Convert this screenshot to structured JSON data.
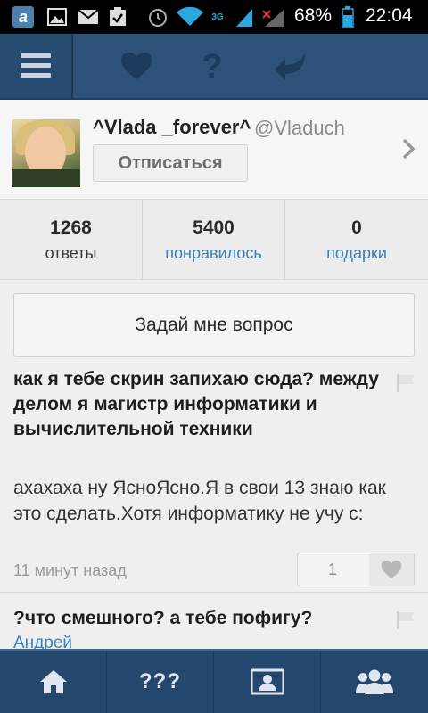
{
  "status_bar": {
    "app_icon_letter": "a",
    "network_type": "3G",
    "battery_percent": "68%",
    "time": "22:04",
    "icons": [
      "app-icon",
      "gallery-icon",
      "mail-icon",
      "clipboard-check-icon",
      "alarm-icon",
      "wifi-icon",
      "signal-icon",
      "signal-icon",
      "battery-icon"
    ]
  },
  "nav": {
    "icons": [
      "menu-icon",
      "heart-icon",
      "help-icon",
      "reply-icon"
    ]
  },
  "profile": {
    "name": "^Vlada _forever^",
    "handle": "@Vladuch",
    "unfollow_label": "Отписаться"
  },
  "stats": [
    {
      "value": "1268",
      "label": "ответы"
    },
    {
      "value": "5400",
      "label": "понравилось"
    },
    {
      "value": "0",
      "label": "подарки"
    }
  ],
  "ask_button_label": "Задай мне вопрос",
  "answers": [
    {
      "question": "как я тебе скрин запихаю сюда? между делом я магистр информатики и вычислительной техники",
      "answer": "ахахаха ну ЯсноЯсно.Я в свои 13 знаю как это сделать.Хотя информатику не учу с:",
      "time": "11 минут назад",
      "likes": "1"
    },
    {
      "question": "?что смешного? а тебе пофигу?",
      "author": "Андрей"
    }
  ],
  "tabbar": {
    "qqq_label": "???",
    "icons": [
      "home-icon",
      "questions-icon",
      "profile-card-icon",
      "friends-icon"
    ]
  },
  "colors": {
    "nav_blue": "#2d5178",
    "tab_blue": "#24476e",
    "link_blue": "#3b7fb4"
  }
}
